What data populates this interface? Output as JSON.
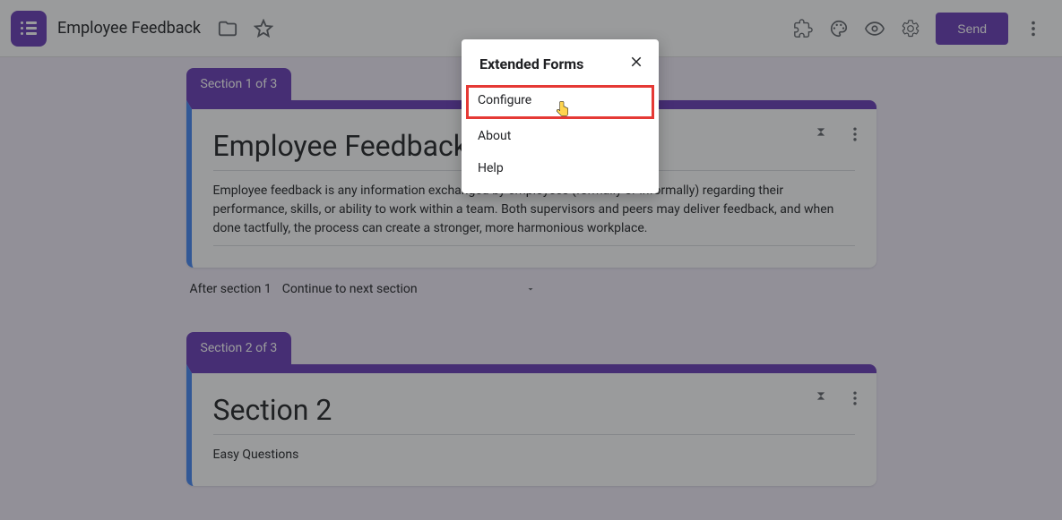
{
  "header": {
    "title": "Employee Feedback",
    "send_label": "Send"
  },
  "sections": {
    "s1": {
      "tab": "Section 1 of 3",
      "title": "Employee Feedback",
      "description": "Employee feedback is any information exchanged by employees (formally or informally) regarding their performance, skills, or ability to work within a team. Both supervisors and peers may deliver feedback, and when done tactfully, the process can create a stronger, more harmonious workplace.",
      "after_label": "After section 1",
      "after_value": "Continue to next section"
    },
    "s2": {
      "tab": "Section 2 of 3",
      "title": "Section 2",
      "description": "Easy Questions"
    }
  },
  "popover": {
    "title": "Extended Forms",
    "items": {
      "configure": "Configure",
      "about": "About",
      "help": "Help"
    }
  }
}
